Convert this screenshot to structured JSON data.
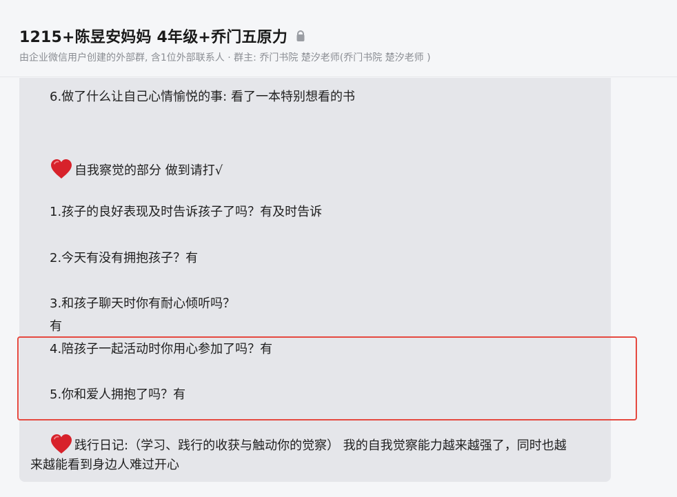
{
  "header": {
    "title": "1215+陈昱安妈妈 4年级+乔门五原力",
    "subtitle": "由企业微信用户创建的外部群, 含1位外部联系人 · 群主: 乔门书院 楚汐老师(乔门书院 楚汐老师 )",
    "lock_icon": "lock-icon"
  },
  "message": {
    "lines": [
      "6.做了什么让自己心情愉悦的事: 看了一本特别想看的书",
      "自我察觉的部分 做到请打√",
      "1.孩子的良好表现及时告诉孩子了吗？有及时告诉",
      "2.今天有没有拥抱孩子？有",
      "3.和孩子聊天时你有耐心倾听吗？",
      "有",
      "4.陪孩子一起活动时你用心参加了吗？有",
      "5.你和爱人拥抱了吗？有",
      "践行日记:（学习、践行的收获与触动你的觉察）   我的自我觉察能力越来越强了，同时也越",
      "来越能看到身边人难过开心"
    ],
    "heart_icon": "heart-icon",
    "highlight_color": "#e5483f",
    "bubble_color": "#e5e6ea"
  }
}
